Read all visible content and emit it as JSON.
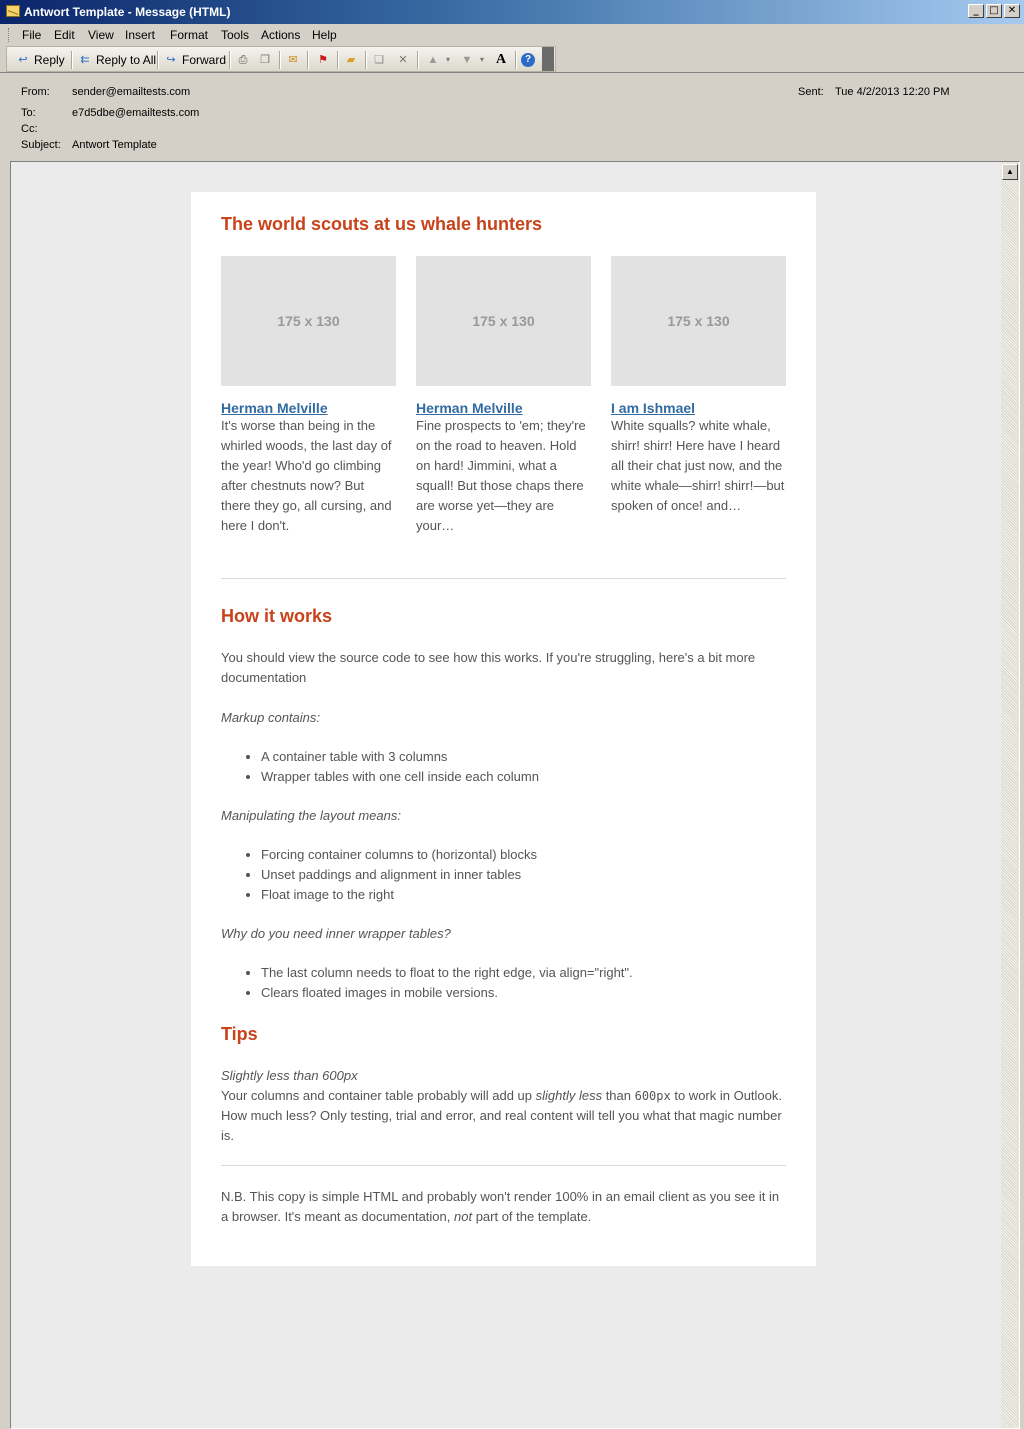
{
  "window": {
    "title": "Antwort Template - Message (HTML)",
    "controls": [
      "_",
      "□",
      "✕"
    ]
  },
  "menu": [
    "File",
    "Edit",
    "View",
    "Insert",
    "Format",
    "Tools",
    "Actions",
    "Help"
  ],
  "toolbar": {
    "reply": "Reply",
    "reply_all": "Reply to All",
    "forward": "Forward"
  },
  "header": {
    "from_label": "From:",
    "from": "sender@emailtests.com",
    "to_label": "To:",
    "to": "e7d5dbe@emailtests.com",
    "cc_label": "Cc:",
    "subject_label": "Subject:",
    "subject": "Antwort Template",
    "sent_label": "Sent:",
    "sent": "Tue 4/2/2013 12:20 PM"
  },
  "email": {
    "heading": "The world scouts at us whale hunters",
    "columns": [
      {
        "image": "175 x 130",
        "name": "Herman Melville",
        "text": "It's worse than being in the whirled woods, the last day of the year! Who'd go climbing after chestnuts now? But there they go, all cursing, and here I don't."
      },
      {
        "image": "175 x 130",
        "name": "Herman Melville",
        "text": "Fine prospects to 'em; they're on the road to heaven. Hold on hard! Jimmini, what a squall! But those chaps there are worse yet—they are your…"
      },
      {
        "image": "175 x 130",
        "name": "I am Ishmael",
        "text": "White squalls? white whale, shirr! shirr! Here have I heard all their chat just now, and the white whale—shirr! shirr!—but spoken of once! and…"
      }
    ],
    "how_heading": "How it works",
    "how_intro": "You should view the source code to see how this works. If you're struggling, here's a bit more documentation",
    "markup_label": "Markup contains:",
    "markup_items": [
      "A container table with 3 columns",
      "Wrapper tables with one cell inside each column"
    ],
    "layout_label": "Manipulating the layout means:",
    "layout_items": [
      "Forcing container columns to (horizontal) blocks",
      "Unset paddings and alignment in inner tables",
      "Float image to the right"
    ],
    "why_label": "Why do you need inner wrapper tables?",
    "why_items": [
      "The last column needs to float to the right edge, via align=\"right\".",
      "Clears floated images in mobile versions."
    ],
    "tips_heading": "Tips",
    "tip_title": "Slightly less than 600px",
    "tip_text_1": "Your columns and container table probably will add up ",
    "tip_text_em": "slightly less",
    "tip_text_2": " than ",
    "tip_code": "600px",
    "tip_text_3": " to work in Outlook. How much less? Only testing, trial and error, and real content will tell you what that magic number is.",
    "nb_1": "N.B. This copy is simple HTML and probably won't render 100% in an email client as you see it in a browser. It's meant as documentation, ",
    "nb_em": "not",
    "nb_2": " part of the template."
  }
}
